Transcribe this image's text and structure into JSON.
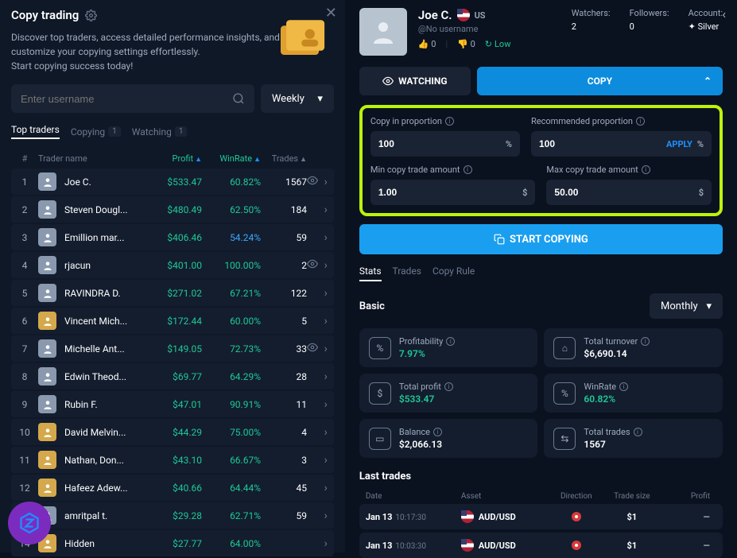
{
  "left": {
    "title": "Copy trading",
    "desc": "Discover top traders, access detailed performance insights, and customize your copying settings effortlessly.\nStart copying success today!",
    "search_placeholder": "Enter username",
    "period": "Weekly",
    "tabs": {
      "top": "Top traders",
      "copying": "Copying",
      "watching": "Watching",
      "copying_count": "1",
      "watching_count": "1"
    },
    "cols": {
      "num": "#",
      "name": "Trader name",
      "profit": "Profit",
      "win": "WinRate",
      "trades": "Trades"
    },
    "traders": [
      {
        "n": "1",
        "name": "Joe C.",
        "profit": "$533.47",
        "win": "60.82%",
        "trades": "1567",
        "eye": true
      },
      {
        "n": "2",
        "name": "Steven Dougl...",
        "profit": "$480.49",
        "win": "62.50%",
        "trades": "184"
      },
      {
        "n": "3",
        "name": "Emillion mar...",
        "profit": "$406.46",
        "win": "54.24%",
        "winBlue": true,
        "trades": "59"
      },
      {
        "n": "4",
        "name": "rjacun",
        "profit": "$401.00",
        "win": "100.00%",
        "trades": "2",
        "eye": true
      },
      {
        "n": "5",
        "name": "RAVINDRA D.",
        "profit": "$271.02",
        "win": "67.21%",
        "trades": "122"
      },
      {
        "n": "6",
        "name": "Vincent Mich...",
        "profit": "$172.44",
        "win": "60.00%",
        "trades": "5",
        "gold": true
      },
      {
        "n": "7",
        "name": "Michelle Ant...",
        "profit": "$149.05",
        "win": "72.73%",
        "trades": "33",
        "eye": true
      },
      {
        "n": "8",
        "name": "Edwin Theod...",
        "profit": "$69.77",
        "win": "64.29%",
        "trades": "28"
      },
      {
        "n": "9",
        "name": "Rubin F.",
        "profit": "$47.01",
        "win": "90.91%",
        "trades": "11"
      },
      {
        "n": "10",
        "name": "David Melvin...",
        "profit": "$44.29",
        "win": "75.00%",
        "trades": "4",
        "gold": true
      },
      {
        "n": "11",
        "name": "Nathan, Don...",
        "profit": "$43.10",
        "win": "66.67%",
        "trades": "3",
        "gold": true
      },
      {
        "n": "12",
        "name": "Hafeez Adew...",
        "profit": "$40.66",
        "win": "64.44%",
        "trades": "45",
        "gold": true
      },
      {
        "n": "13",
        "name": "amritpal t.",
        "profit": "$29.28",
        "win": "62.71%",
        "trades": "59"
      },
      {
        "n": "14",
        "name": "Hidden",
        "profit": "$27.77",
        "win": "64.00%",
        "trades": "",
        "gold": true
      }
    ]
  },
  "right": {
    "name": "Joe C.",
    "country": "US",
    "username": "@No username",
    "upvotes": "0",
    "downvotes": "0",
    "risk": "Low",
    "watchers_lbl": "Watchers:",
    "watchers": "2",
    "followers_lbl": "Followers:",
    "followers": "0",
    "account_lbl": "Account:",
    "account": "Silver",
    "watching_btn": "WATCHING",
    "copy_btn": "COPY",
    "copy_prop_lbl": "Copy in proportion",
    "copy_prop_val": "100",
    "rec_prop_lbl": "Recommended proportion",
    "rec_prop_val": "100",
    "apply": "APPLY",
    "min_lbl": "Min copy trade amount",
    "min_val": "1.00",
    "max_lbl": "Max copy trade amount",
    "max_val": "50.00",
    "start_btn": "START COPYING",
    "subtabs": {
      "stats": "Stats",
      "trades": "Trades",
      "rule": "Copy Rule"
    },
    "basic": "Basic",
    "monthly": "Monthly",
    "cards": {
      "profitability": {
        "lbl": "Profitability",
        "val": "7.97%"
      },
      "turnover": {
        "lbl": "Total turnover",
        "val": "$6,690.14"
      },
      "totalprofit": {
        "lbl": "Total profit",
        "val": "$533.47"
      },
      "winrate": {
        "lbl": "WinRate",
        "val": "60.82%"
      },
      "balance": {
        "lbl": "Balance",
        "val": "$2,066.13"
      },
      "totaltrades": {
        "lbl": "Total trades",
        "val": "1567"
      }
    },
    "last_trades": "Last trades",
    "lt_cols": {
      "date": "Date",
      "asset": "Asset",
      "dir": "Direction",
      "size": "Trade size",
      "profit": "Profit"
    },
    "trades_list": [
      {
        "date": "Jan 13",
        "time": "10:17:30",
        "asset": "AUD/USD",
        "size": "$1",
        "profit": "—"
      },
      {
        "date": "Jan 13",
        "time": "10:03:30",
        "asset": "AUD/USD",
        "size": "$1",
        "profit": "—"
      }
    ]
  }
}
